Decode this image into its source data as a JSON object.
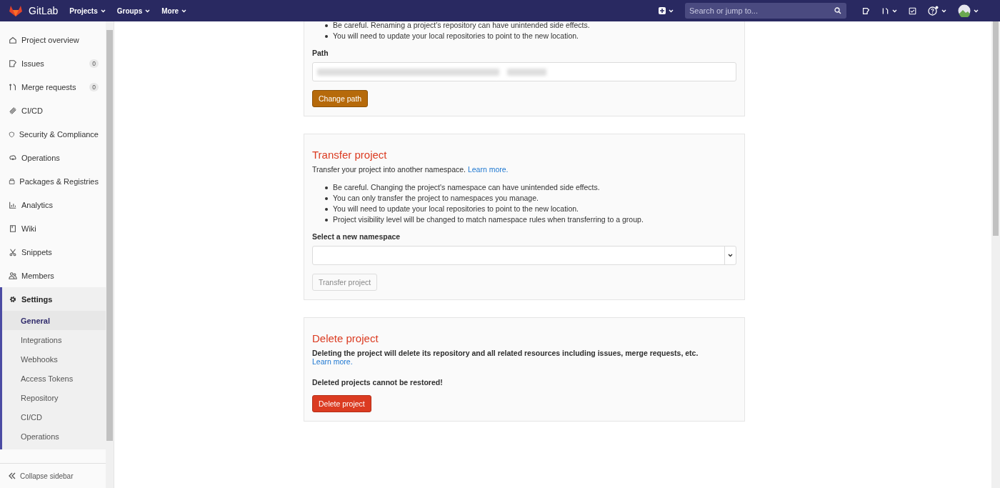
{
  "navbar": {
    "brand": "GitLab",
    "menus": [
      {
        "label": "Projects"
      },
      {
        "label": "Groups"
      },
      {
        "label": "More"
      }
    ],
    "search": {
      "placeholder": "Search or jump to..."
    }
  },
  "sidebar": {
    "items": [
      {
        "label": "Project overview",
        "selected": false
      },
      {
        "label": "Issues",
        "count": "0",
        "selected": false
      },
      {
        "label": "Merge requests",
        "count": "0",
        "selected": false
      },
      {
        "label": "CI/CD",
        "selected": false
      },
      {
        "label": "Security & Compliance",
        "selected": false
      },
      {
        "label": "Operations",
        "selected": false
      },
      {
        "label": "Packages & Registries",
        "selected": false
      },
      {
        "label": "Analytics",
        "selected": false
      },
      {
        "label": "Wiki",
        "selected": false
      },
      {
        "label": "Snippets",
        "selected": false
      },
      {
        "label": "Members",
        "selected": false
      },
      {
        "label": "Settings",
        "selected": true,
        "children": [
          {
            "label": "General",
            "selected": true
          },
          {
            "label": "Integrations",
            "selected": false
          },
          {
            "label": "Webhooks",
            "selected": false
          },
          {
            "label": "Access Tokens",
            "selected": false
          },
          {
            "label": "Repository",
            "selected": false
          },
          {
            "label": "CI/CD",
            "selected": false
          },
          {
            "label": "Operations",
            "selected": false
          }
        ]
      }
    ],
    "footer": "Collapse sidebar"
  },
  "rename": {
    "bullets": [
      "Be careful. Renaming a project's repository can have unintended side effects.",
      "You will need to update your local repositories to point to the new location."
    ],
    "field_label": "Path",
    "button": "Change path"
  },
  "transfer": {
    "title": "Transfer project",
    "description": "Transfer your project into another namespace.",
    "link": "Learn more.",
    "bullets": [
      "Be careful. Changing the project's namespace can have unintended side effects.",
      "You can only transfer the project to namespaces you manage.",
      "You will need to update your local repositories to point to the new location.",
      "Project visibility level will be changed to match namespace rules when transferring to a group."
    ],
    "field_label": "Select a new namespace",
    "button": {
      "label": "Transfer project",
      "disabled": true
    }
  },
  "delete": {
    "title": "Delete project",
    "description": "Deleting the project will delete its repository and all related resources including issues, merge requests, etc.",
    "link": "Learn more.",
    "warning": "Deleted projects cannot be restored!",
    "button": "Delete project"
  }
}
